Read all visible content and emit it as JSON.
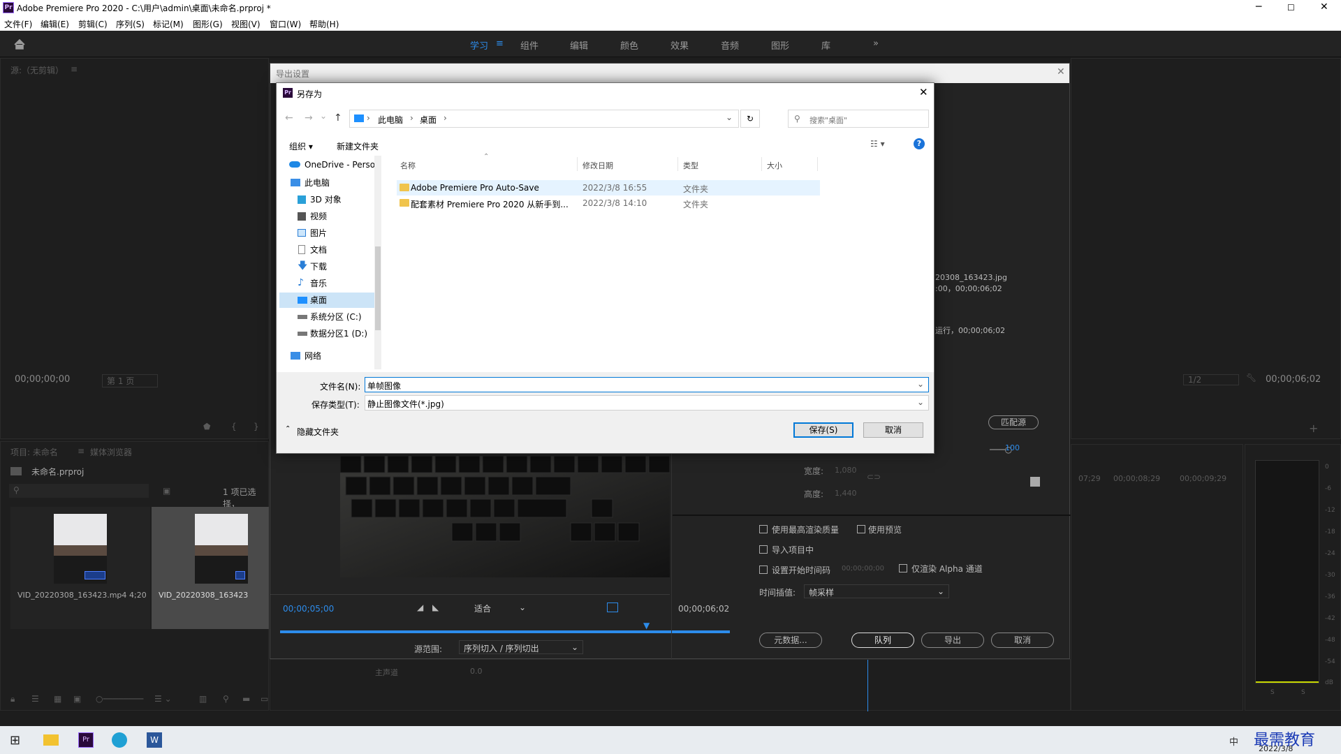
{
  "window": {
    "app_icon": "Pr",
    "title": "Adobe Premiere Pro 2020 - C:\\用户\\admin\\桌面\\未命名.prproj *",
    "minimize": "─",
    "maximize": "☐",
    "close": "✕"
  },
  "menu": [
    "文件(F)",
    "编辑(E)",
    "剪辑(C)",
    "序列(S)",
    "标记(M)",
    "图形(G)",
    "视图(V)",
    "窗口(W)",
    "帮助(H)"
  ],
  "workspaces": [
    "学习",
    "组件",
    "编辑",
    "颜色",
    "效果",
    "音频",
    "图形",
    "库"
  ],
  "workspace_active": "学习",
  "workspace_more": "»",
  "source_panel": {
    "title": "源:（无剪辑）",
    "menu": "≡",
    "timecode": "00;00;00;00",
    "page": "第 1 页"
  },
  "project_panel": {
    "tab": "项目: 未命名",
    "tab2": "媒体浏览器",
    "project_file": "未命名.prproj",
    "selection_info": "1 项已选择，",
    "items": [
      {
        "name": "VID_20220308_163423.mp4",
        "duration": "4;20"
      },
      {
        "name": "VID_20220308_163423"
      }
    ]
  },
  "export_dialog": {
    "title": "导出设置",
    "close": "✕",
    "preview_start": "00;00;05;00",
    "preview_end": "00;00;06;02",
    "fit": "适合",
    "source_range_label": "源范围:",
    "source_range_value": "序列切入 / 序列切出",
    "right_file": "20308_163423.jpg",
    "right_info1": ":00，00;00;06;02",
    "right_info2": "运行，00;00;06;02",
    "match_source": "匹配源",
    "scale_value": "100",
    "width_label": "宽度:",
    "width_value": "1,080",
    "height_label": "高度:",
    "height_value": "1,440",
    "opt_max_quality": "使用最高渲染质量",
    "opt_preview": "使用预览",
    "opt_import": "导入项目中",
    "opt_start_tc": "设置开始时间码",
    "opt_start_tc_value": "00;00;00;00",
    "opt_alpha": "仅渲染 Alpha 通道",
    "interp_label": "时间插值:",
    "interp_value": "帧采样",
    "btn_metadata": "元数据...",
    "btn_queue": "队列",
    "btn_export": "导出",
    "btn_cancel": "取消"
  },
  "program_panel": {
    "page": "1/2",
    "timecode": "00;00;06;02",
    "times": [
      "07;29",
      "00;00;08;29",
      "00;00;09;29"
    ],
    "track": "主声道",
    "track_value": "0.0"
  },
  "meter": {
    "labels": [
      "0",
      "-6",
      "-12",
      "-18",
      "-24",
      "-30",
      "-36",
      "-42",
      "-48",
      "-54",
      "dB"
    ],
    "solo": "S"
  },
  "save_dialog": {
    "icon": "Pr",
    "title": "另存为",
    "close": "✕",
    "back": "←",
    "forward": "→",
    "recent": "⌄",
    "up": "↑",
    "breadcrumb": [
      "此电脑",
      "桌面"
    ],
    "crumb_sep": "›",
    "address_dropdown": "⌄",
    "refresh": "↻",
    "search_placeholder": "搜索\"桌面\"",
    "search_icon": "⚲",
    "organize": "组织 ▾",
    "new_folder": "新建文件夹",
    "view_toggle": "☷ ▾",
    "help": "?",
    "sort_arrow": "⌃",
    "nav_items": [
      {
        "label": "OneDrive - Perso",
        "icon": "cloud-icon"
      },
      {
        "label": "此电脑",
        "icon": "computer-icon"
      },
      {
        "label": "3D 对象",
        "icon": "cube-icon"
      },
      {
        "label": "视频",
        "icon": "video-icon"
      },
      {
        "label": "图片",
        "icon": "picture-icon"
      },
      {
        "label": "文档",
        "icon": "document-icon"
      },
      {
        "label": "下载",
        "icon": "download-icon"
      },
      {
        "label": "音乐",
        "icon": "music-icon"
      },
      {
        "label": "桌面",
        "icon": "desktop-icon",
        "selected": true
      },
      {
        "label": "系统分区 (C:)",
        "icon": "drive-icon"
      },
      {
        "label": "数据分区1 (D:)",
        "icon": "drive-icon"
      },
      {
        "label": "网络",
        "icon": "network-icon"
      }
    ],
    "columns": [
      "名称",
      "修改日期",
      "类型",
      "大小"
    ],
    "files": [
      {
        "name": "Adobe Premiere Pro Auto-Save",
        "date": "2022/3/8 16:55",
        "type": "文件夹"
      },
      {
        "name": "配套素材 Premiere Pro 2020 从新手到...",
        "date": "2022/3/8 14:10",
        "type": "文件夹"
      }
    ],
    "filename_label": "文件名(N):",
    "filename_value": "单帧图像",
    "filetype_label": "保存类型(T):",
    "filetype_value": "静止图像文件(*.jpg)",
    "hide_folders": "隐藏文件夹",
    "save": "保存(S)",
    "cancel": "取消"
  },
  "taskbar": {
    "date": "2022/3/8",
    "ime": "中",
    "watermark": "最需教育"
  }
}
